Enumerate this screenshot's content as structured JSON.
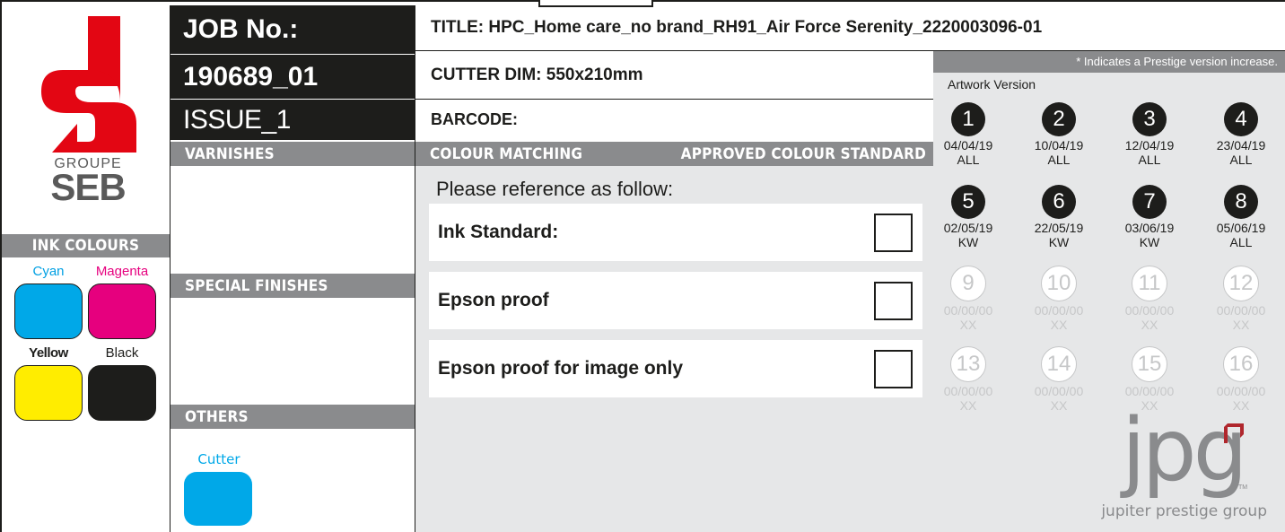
{
  "logo": {
    "brand_top": "GROUPE",
    "brand_bottom": "SEB",
    "brand_color": "#e30613"
  },
  "job": {
    "label": "JOB No.:",
    "number": "190689_01",
    "issue": "ISSUE_1"
  },
  "title": "TITLE: HPC_Home care_no brand_RH91_Air Force Serenity_2220003096-01",
  "cutter_dim": "CUTTER DIM: 550x210mm",
  "barcode": "BARCODE:",
  "sections": {
    "ink_colours": "INK COLOURS",
    "varnishes": "VARNISHES",
    "special_finishes": "SPECIAL FINISHES",
    "others": "OTHERS",
    "colour_matching": "COLOUR MATCHING",
    "approved_standard": "APPROVED COLOUR STANDARD"
  },
  "inks": [
    {
      "name": "Cyan",
      "color": "#00a8e8",
      "label_color": "#00a0e3"
    },
    {
      "name": "Magenta",
      "color": "#e6007e",
      "label_color": "#e6007e"
    },
    {
      "name": "Yellow",
      "color": "#ffed00",
      "label_color": "#1d1d1b"
    },
    {
      "name": "Black",
      "color": "#1d1d1b",
      "label_color": "#1d1d1b"
    }
  ],
  "others": {
    "cutter_label": "Cutter",
    "cutter_color": "#00a8e8"
  },
  "colour_matching": {
    "intro": "Please reference as follow:",
    "options": [
      {
        "label": "Ink Standard:"
      },
      {
        "label": "Epson proof"
      },
      {
        "label": "Epson proof for image only"
      }
    ]
  },
  "artwork": {
    "note": "* Indicates a Prestige version increase.",
    "heading": "Artwork Version",
    "versions": [
      {
        "num": "1",
        "date": "04/04/19",
        "code": "ALL",
        "active": true
      },
      {
        "num": "2",
        "date": "10/04/19",
        "code": "ALL",
        "active": true
      },
      {
        "num": "3",
        "date": "12/04/19",
        "code": "ALL",
        "active": true
      },
      {
        "num": "4",
        "date": "23/04/19",
        "code": "ALL",
        "active": true
      },
      {
        "num": "5",
        "date": "02/05/19",
        "code": "KW",
        "active": true
      },
      {
        "num": "6",
        "date": "22/05/19",
        "code": "KW",
        "active": true
      },
      {
        "num": "7",
        "date": "03/06/19",
        "code": "KW",
        "active": true
      },
      {
        "num": "8",
        "date": "05/06/19",
        "code": "ALL",
        "active": true
      },
      {
        "num": "9",
        "date": "00/00/00",
        "code": "XX",
        "active": false
      },
      {
        "num": "10",
        "date": "00/00/00",
        "code": "XX",
        "active": false
      },
      {
        "num": "11",
        "date": "00/00/00",
        "code": "XX",
        "active": false
      },
      {
        "num": "12",
        "date": "00/00/00",
        "code": "XX",
        "active": false
      },
      {
        "num": "13",
        "date": "00/00/00",
        "code": "XX",
        "active": false
      },
      {
        "num": "14",
        "date": "00/00/00",
        "code": "XX",
        "active": false
      },
      {
        "num": "15",
        "date": "00/00/00",
        "code": "XX",
        "active": false
      },
      {
        "num": "16",
        "date": "00/00/00",
        "code": "XX",
        "active": false
      }
    ]
  },
  "jpg": {
    "mark": "jpg",
    "tm": "TM",
    "tagline": "jupiter prestige group",
    "accent": "#b0272d"
  }
}
